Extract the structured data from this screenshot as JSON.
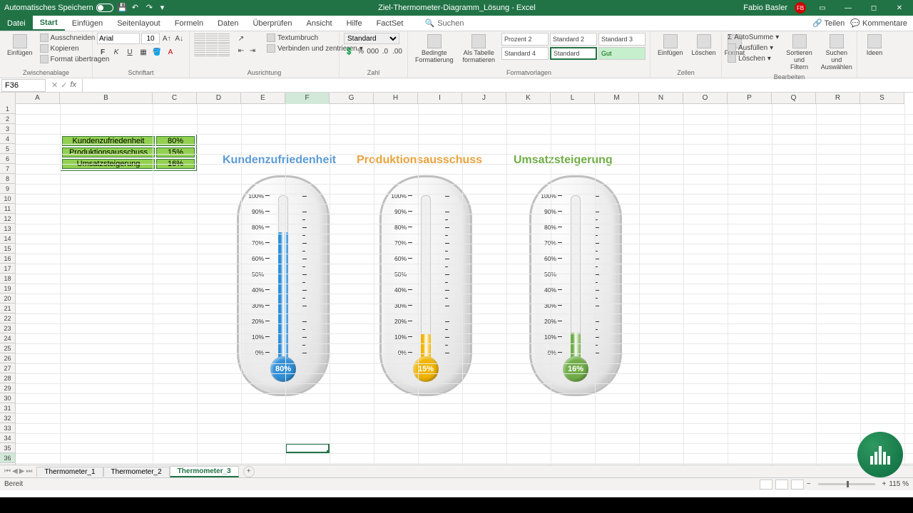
{
  "titlebar": {
    "autosave": "Automatisches Speichern",
    "doc_title": "Ziel-Thermometer-Diagramm_Lösung - Excel",
    "user": "Fabio Basler",
    "user_initials": "FB"
  },
  "tabs": {
    "file": "Datei",
    "start": "Start",
    "einfuegen": "Einfügen",
    "seitenlayout": "Seitenlayout",
    "formeln": "Formeln",
    "daten": "Daten",
    "ueberpruefen": "Überprüfen",
    "ansicht": "Ansicht",
    "hilfe": "Hilfe",
    "factset": "FactSet",
    "suchen": "Suchen",
    "teilen": "Teilen",
    "kommentare": "Kommentare"
  },
  "ribbon": {
    "clipboard": {
      "einfuegen": "Einfügen",
      "ausschneiden": "Ausschneiden",
      "kopieren": "Kopieren",
      "format": "Format übertragen",
      "label": "Zwischenablage"
    },
    "font": {
      "name": "Arial",
      "size": "10",
      "label": "Schriftart"
    },
    "align": {
      "textumbruch": "Textumbruch",
      "verbinden": "Verbinden und zentrieren",
      "label": "Ausrichtung"
    },
    "number": {
      "fmt": "Standard",
      "label": "Zahl"
    },
    "styles": {
      "bedingte": "Bedingte\nFormatierung",
      "tabelle": "Als Tabelle\nformatieren",
      "p2": "Prozent 2",
      "s2": "Standard 2",
      "s3": "Standard 3",
      "s4": "Standard 4",
      "std": "Standard",
      "gut": "Gut",
      "label": "Formatvorlagen"
    },
    "cells": {
      "einfuegen": "Einfügen",
      "loeschen": "Löschen",
      "format": "Format",
      "label": "Zellen"
    },
    "edit": {
      "autosumme": "AutoSumme",
      "ausfuellen": "Ausfüllen",
      "loeschen": "Löschen",
      "sort": "Sortieren und\nFiltern",
      "find": "Suchen und\nAuswählen",
      "label": "Bearbeiten"
    },
    "ideas": {
      "ideen": "Ideen"
    }
  },
  "namebox": "F36",
  "columns": [
    "A",
    "B",
    "C",
    "D",
    "E",
    "F",
    "G",
    "H",
    "I",
    "J",
    "K",
    "L",
    "M",
    "N",
    "O",
    "P",
    "Q",
    "R",
    "S"
  ],
  "data_table": {
    "rows": [
      {
        "label": "Kundenzufriedenheit",
        "value": "80%"
      },
      {
        "label": "Produktionsausschuss",
        "value": "15%"
      },
      {
        "label": "Umsatzsteigerung",
        "value": "16%"
      }
    ]
  },
  "chart_data": [
    {
      "type": "gauge-thermometer",
      "title": "Kundenzufriedenheit",
      "value": 80,
      "unit": "%",
      "ylim": [
        0,
        100
      ],
      "ticks": [
        0,
        10,
        20,
        30,
        40,
        50,
        60,
        70,
        80,
        90,
        100
      ],
      "color": "#2f8fd8",
      "title_color": "#5b9bd5"
    },
    {
      "type": "gauge-thermometer",
      "title": "Produktionsausschuss",
      "value": 15,
      "unit": "%",
      "ylim": [
        0,
        100
      ],
      "ticks": [
        0,
        10,
        20,
        30,
        40,
        50,
        60,
        70,
        80,
        90,
        100
      ],
      "color": "#f0b400",
      "title_color": "#e8a33d"
    },
    {
      "type": "gauge-thermometer",
      "title": "Umsatzsteigerung",
      "value": 16,
      "unit": "%",
      "ylim": [
        0,
        100
      ],
      "ticks": [
        0,
        10,
        20,
        30,
        40,
        50,
        60,
        70,
        80,
        90,
        100
      ],
      "color": "#70ad47",
      "title_color": "#70ad47"
    }
  ],
  "sheets": {
    "t1": "Thermometer_1",
    "t2": "Thermometer_2",
    "t3": "Thermometer_3"
  },
  "status": {
    "ready": "Bereit",
    "zoom": "115 %"
  }
}
